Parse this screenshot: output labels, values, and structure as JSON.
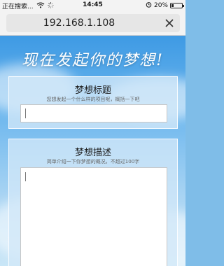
{
  "status_bar": {
    "carrier": "正在搜索...",
    "time": "14:45",
    "battery_percent": "20%",
    "battery_level": 0.2
  },
  "address_bar": {
    "url": "192.168.1.108"
  },
  "page": {
    "hero_title": "现在发起你的梦想!",
    "title_card": {
      "heading": "梦想标题",
      "hint": "您想发起一个什么样的项目呢，概括一下吧",
      "value": ""
    },
    "desc_card": {
      "heading": "梦想描述",
      "hint": "简单介绍一下你梦想的概况，不超过100字",
      "value": ""
    }
  },
  "colors": {
    "accent": "#2f8de4",
    "sky_top": "#3e9ae4",
    "sky_bottom": "#c9e6f7"
  }
}
